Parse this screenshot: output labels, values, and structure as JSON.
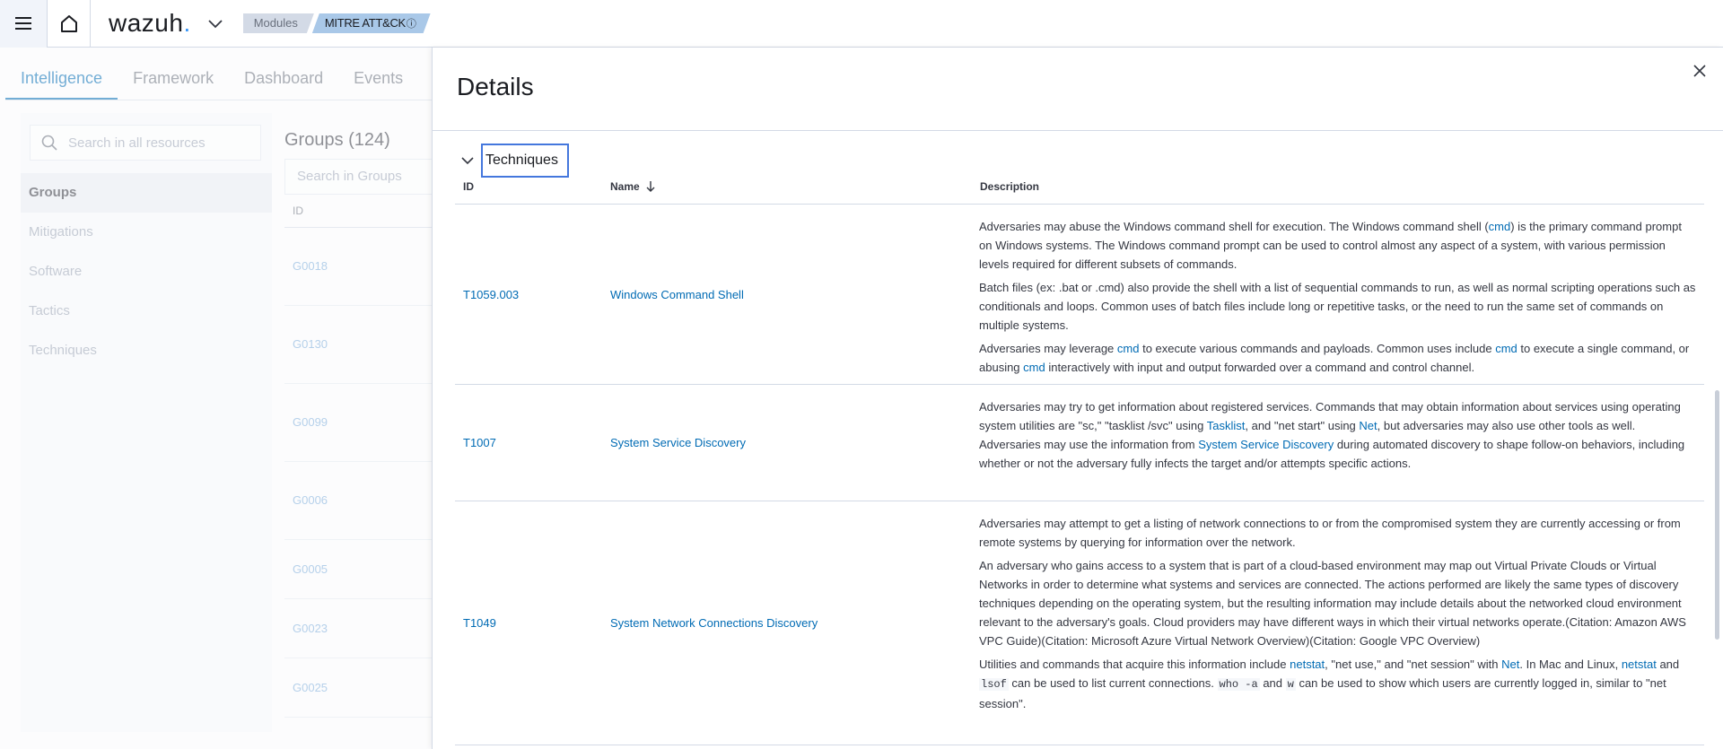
{
  "header": {
    "logo_text": "wazuh",
    "logo_dot": ".",
    "breadcrumb": [
      "Modules",
      "MITRE ATT&CK"
    ],
    "breadcrumb_info_glyph": "ⓘ"
  },
  "background": {
    "tabs": [
      "Intelligence",
      "Framework",
      "Dashboard",
      "Events"
    ],
    "active_tab": "Intelligence",
    "search_placeholder": "Search in all resources",
    "sidebar": [
      "Groups",
      "Mitigations",
      "Software",
      "Tactics",
      "Techniques"
    ],
    "active_sidebar": "Groups",
    "groups_title": "Groups (124)",
    "groups_search_placeholder": "Search in Groups",
    "groups_col_id": "ID",
    "group_ids": [
      "G0018",
      "G0130",
      "G0099",
      "G0006",
      "G0005",
      "G0023",
      "G0025"
    ]
  },
  "flyout": {
    "title": "Details",
    "section_title": "Techniques",
    "columns": {
      "id": "ID",
      "name": "Name",
      "description": "Description"
    },
    "sort_column": "Name",
    "sort_direction": "descending",
    "rows": [
      {
        "id": "T1059.003",
        "name": "Windows Command Shell",
        "paragraphs": [
          [
            {
              "t": "Adversaries may abuse the Windows command shell for execution. The Windows command shell ("
            },
            {
              "t": "cmd",
              "link": true
            },
            {
              "t": ") is the primary command prompt on Windows systems. The Windows command prompt can be used to control almost any aspect of a system, with various permission levels required for different subsets of commands."
            }
          ],
          [
            {
              "t": "Batch files (ex: .bat or .cmd) also provide the shell with a list of sequential commands to run, as well as normal scripting operations such as conditionals and loops. Common uses of batch files include long or repetitive tasks, or the need to run the same set of commands on multiple systems."
            }
          ],
          [
            {
              "t": "Adversaries may leverage "
            },
            {
              "t": "cmd",
              "link": true
            },
            {
              "t": " to execute various commands and payloads. Common uses include "
            },
            {
              "t": "cmd",
              "link": true
            },
            {
              "t": " to execute a single command, or abusing "
            },
            {
              "t": "cmd",
              "link": true
            },
            {
              "t": " interactively with input and output forwarded over a command and control channel."
            }
          ]
        ]
      },
      {
        "id": "T1007",
        "name": "System Service Discovery",
        "paragraphs": [
          [
            {
              "t": "Adversaries may try to get information about registered services. Commands that may obtain information about services using operating system utilities are \"sc,\" \"tasklist /svc\" using "
            },
            {
              "t": "Tasklist",
              "link": true
            },
            {
              "t": ", and \"net start\" using "
            },
            {
              "t": "Net",
              "link": true
            },
            {
              "t": ", but adversaries may also use other tools as well. Adversaries may use the information from "
            },
            {
              "t": "System Service Discovery",
              "link": true
            },
            {
              "t": " during automated discovery to shape follow-on behaviors, including whether or not the adversary fully infects the target and/or attempts specific actions."
            }
          ]
        ]
      },
      {
        "id": "T1049",
        "name": "System Network Connections Discovery",
        "paragraphs": [
          [
            {
              "t": "Adversaries may attempt to get a listing of network connections to or from the compromised system they are currently accessing or from remote systems by querying for information over the network."
            }
          ],
          [
            {
              "t": "An adversary who gains access to a system that is part of a cloud-based environment may map out Virtual Private Clouds or Virtual Networks in order to determine what systems and services are connected. The actions performed are likely the same types of discovery techniques depending on the operating system, but the resulting information may include details about the networked cloud environment relevant to the adversary's goals. Cloud providers may have different ways in which their virtual networks operate.(Citation: Amazon AWS VPC Guide)(Citation: Microsoft Azure Virtual Network Overview)(Citation: Google VPC Overview)"
            }
          ],
          [
            {
              "t": "Utilities and commands that acquire this information include "
            },
            {
              "t": "netstat",
              "link": true
            },
            {
              "t": ", \"net use,\" and \"net session\" with "
            },
            {
              "t": "Net",
              "link": true
            },
            {
              "t": ". In Mac and Linux, "
            },
            {
              "t": "netstat",
              "link": true
            },
            {
              "t": " and "
            },
            {
              "t": "lsof",
              "code": true
            },
            {
              "t": " can be used to list current connections. "
            },
            {
              "t": "who -a",
              "code": true
            },
            {
              "t": " and "
            },
            {
              "t": "w",
              "code": true
            },
            {
              "t": " can be used to show which users are currently logged in, similar to \"net session\"."
            }
          ]
        ]
      }
    ]
  },
  "colors": {
    "accent": "#006bb4",
    "focus_ring": "#4477dd",
    "border": "#d3dae6"
  },
  "icons": [
    "menu-icon",
    "home-icon",
    "chevron-down-icon",
    "info-icon",
    "search-icon",
    "close-icon",
    "sort-arrow-icon"
  ]
}
